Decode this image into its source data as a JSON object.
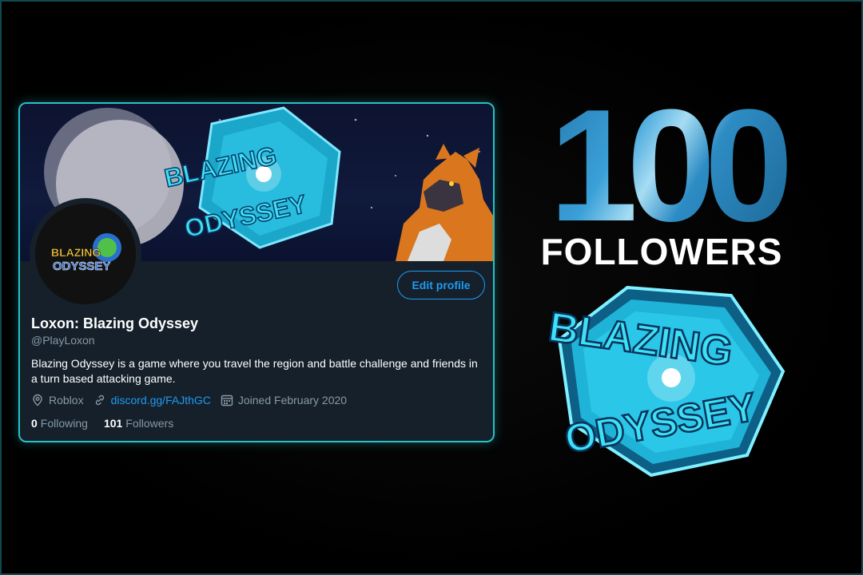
{
  "profile": {
    "display_name": "Loxon: Blazing Odyssey",
    "handle": "@PlayLoxon",
    "bio": "Blazing Odyssey is a game where you travel the region and battle challenge and friends in a turn based attacking game.",
    "edit_button": "Edit profile",
    "location": "Roblox",
    "website": "discord.gg/FAJthGC",
    "joined": "Joined February 2020",
    "following_count": "0",
    "following_label": "Following",
    "followers_count": "101",
    "followers_label": "Followers",
    "banner_logo_line1": "BLAZING",
    "banner_logo_line2": "ODYSSEY",
    "avatar_logo_line1": "BLAZING",
    "avatar_logo_line2": "ODYSSEY"
  },
  "milestone": {
    "count": "100",
    "label": "FOLLOWERS",
    "logo_line1": "BLAZING",
    "logo_line2": "ODYSSEY"
  },
  "colors": {
    "accent": "#1d9bf0",
    "card_bg": "#15202b",
    "card_border": "#27c1c8",
    "logo_cyan": "#3ee0f5"
  }
}
